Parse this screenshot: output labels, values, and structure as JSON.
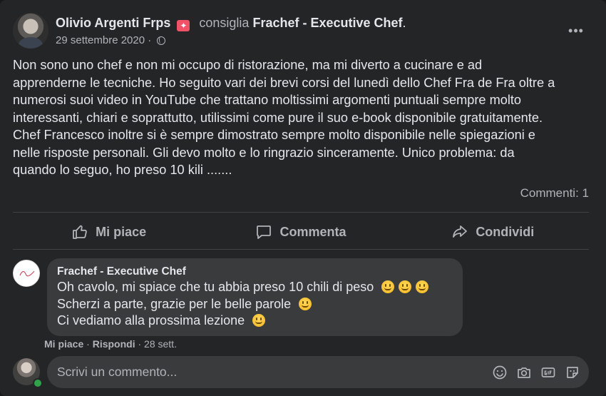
{
  "post": {
    "author": "Olivio Argenti Frps",
    "badge": "✦",
    "verb": "consiglia",
    "page": "Frachef - Executive Chef",
    "page_suffix": ".",
    "date": "29 settembre 2020",
    "date_sep": "·",
    "more": "•••",
    "text": "Non sono uno chef e non mi occupo di ristorazione, ma mi diverto a cucinare e ad\napprenderne le tecniche. Ho seguito vari dei brevi corsi del lunedì dello Chef Fra de Fra oltre a\nnumerosi suoi video in YouTube che trattano moltissimi argomenti puntuali sempre molto\ninteressanti,  chiari e soprattutto, utilissimi come pure il suo e-book disponibile gratuitamente.\nChef Francesco inoltre si è sempre dimostrato sempre molto disponibile nelle spiegazioni e\nnelle risposte personali. Gli devo molto e lo ringrazio sinceramente. Unico problema: da\nquando lo seguo, ho preso 10 kili .......",
    "comment_count": "Commenti: 1"
  },
  "actions": {
    "like": "Mi piace",
    "comment": "Commenta",
    "share": "Condividi"
  },
  "comment": {
    "author": "Frachef - Executive Chef",
    "line1": "Oh cavolo, mi spiace che tu abbia preso 10 chili di peso",
    "line2": "Scherzi a parte, grazie per le belle parole",
    "line3": "Ci vediamo alla prossima lezione",
    "like": "Mi piace",
    "sep": "·",
    "reply": "Rispondi",
    "time": "28 sett."
  },
  "composer": {
    "placeholder": "Scrivi un commento..."
  },
  "colors": {
    "background": "#242526",
    "bubble": "#3a3b3c",
    "online": "#31a24c",
    "badge": "#f25268"
  }
}
